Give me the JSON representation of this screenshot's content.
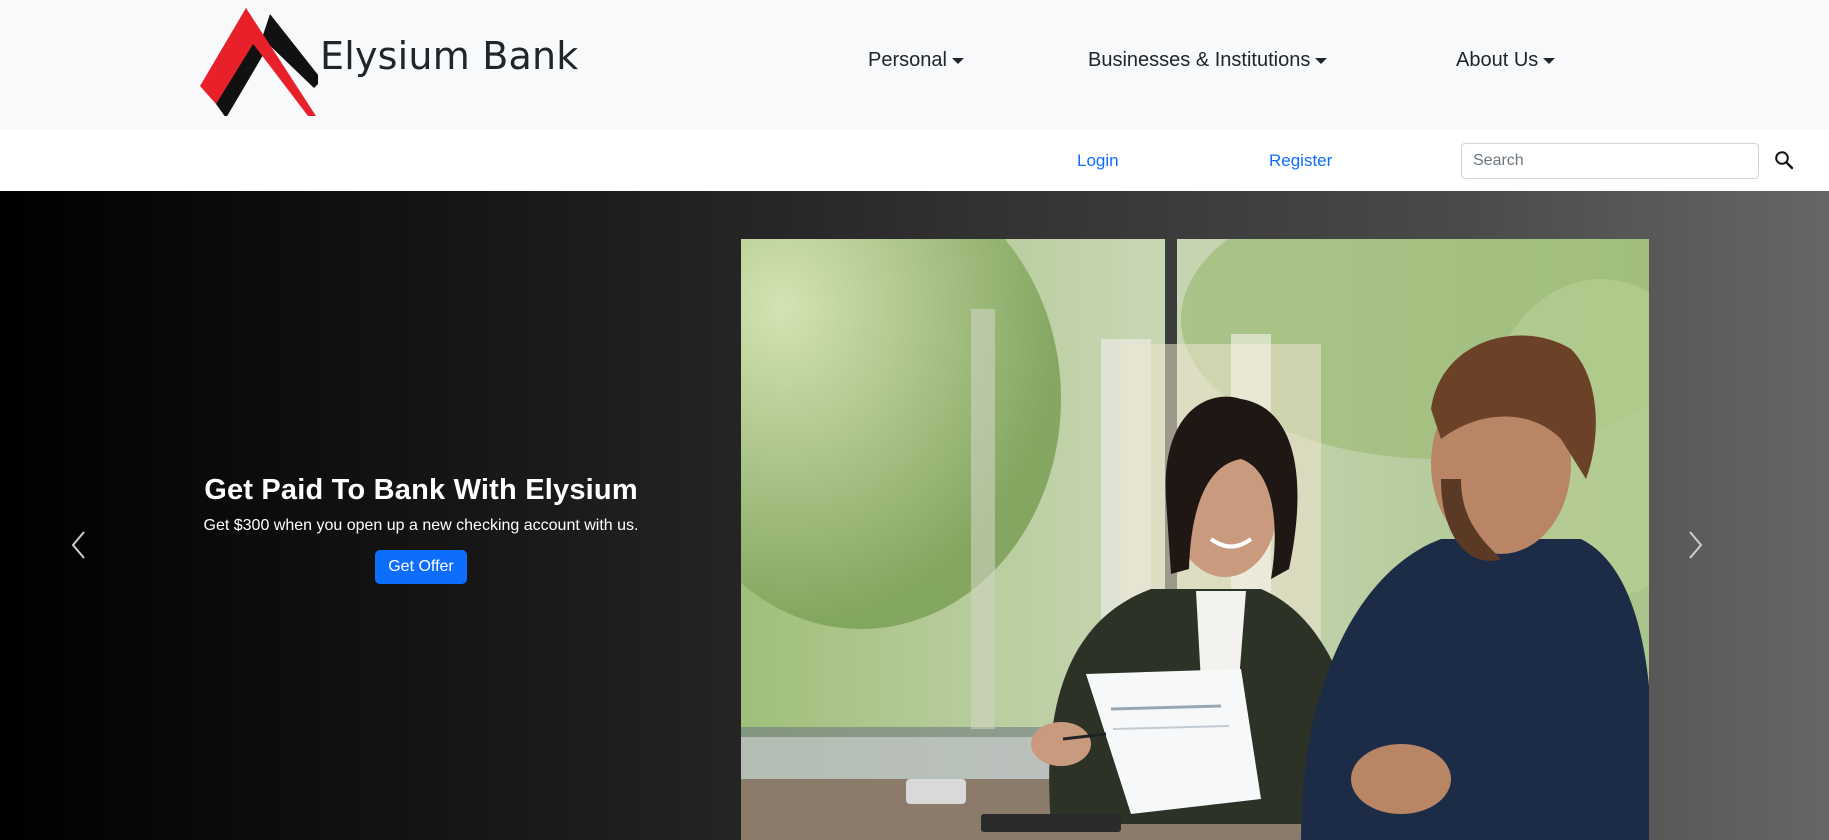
{
  "brand": {
    "name": "Elysium Bank",
    "logo_colors": {
      "red": "#e8202a",
      "black": "#111111"
    }
  },
  "nav": {
    "personal": "Personal",
    "business": "Businesses & Institutions",
    "about": "About Us"
  },
  "account_links": {
    "login": "Login",
    "register": "Register"
  },
  "search": {
    "placeholder": "Search",
    "value": "",
    "icon": "search-icon"
  },
  "hero": {
    "title": "Get Paid To Bank With Elysium",
    "subtitle": "Get $300 when you open up a new checking account with us.",
    "cta_label": "Get Offer",
    "prev_icon": "chevron-left-icon",
    "next_icon": "chevron-right-icon",
    "image": "photo of a banker woman smiling and talking with a male client at a desk"
  },
  "colors": {
    "accent": "#0d6efd",
    "header_bg": "#f8f9fa"
  }
}
